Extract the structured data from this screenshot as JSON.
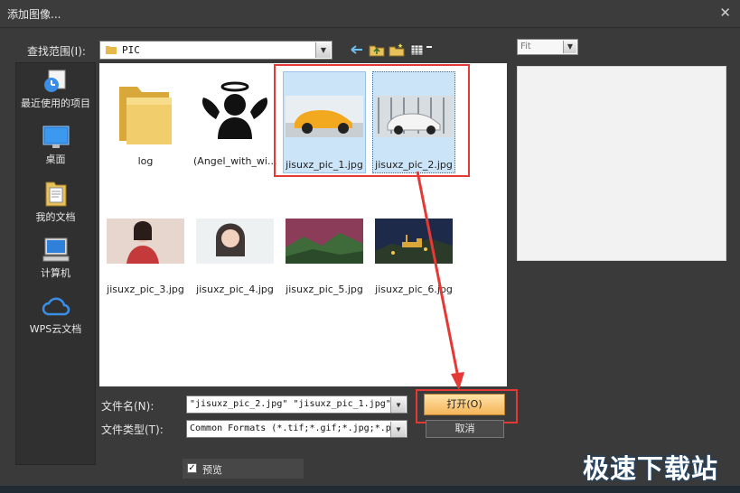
{
  "window": {
    "title": "添加图像...",
    "close_icon": "close-icon"
  },
  "lookin": {
    "label": "查找范围(I):",
    "value": "PIC"
  },
  "places": [
    {
      "label": "最近使用的项目",
      "icon": "recent-items-icon"
    },
    {
      "label": "桌面",
      "icon": "desktop-icon"
    },
    {
      "label": "我的文档",
      "icon": "documents-icon"
    },
    {
      "label": "计算机",
      "icon": "computer-icon"
    },
    {
      "label": "WPS云文档",
      "icon": "cloud-icon"
    }
  ],
  "files": [
    {
      "label": "log",
      "type": "folder"
    },
    {
      "label": "(Angel_with_wi...",
      "type": "image"
    },
    {
      "label": "jisuxz_pic_1.jpg",
      "type": "image",
      "selected": true
    },
    {
      "label": "jisuxz_pic_2.jpg",
      "type": "image",
      "selected": true
    },
    {
      "label": "jisuxz_pic_3.jpg",
      "type": "image"
    },
    {
      "label": "jisuxz_pic_4.jpg",
      "type": "image"
    },
    {
      "label": "jisuxz_pic_5.jpg",
      "type": "image"
    },
    {
      "label": "jisuxz_pic_6.jpg",
      "type": "image"
    }
  ],
  "filename": {
    "label": "文件名(N):",
    "value": "\"jisuxz_pic_2.jpg\" \"jisuxz_pic_1.jpg\""
  },
  "filetype": {
    "label": "文件类型(T):",
    "value": "Common Formats (*.tif;*.gif;*.jpg;*.p"
  },
  "buttons": {
    "open": "打开(O)",
    "cancel": "取消"
  },
  "preview": {
    "label": "预览",
    "checked": true,
    "fit": "Fit"
  },
  "watermark": "极速下载站",
  "colors": {
    "highlight": "#e53935",
    "open_button": "#f5b55a",
    "selection": "#cce4f7"
  }
}
